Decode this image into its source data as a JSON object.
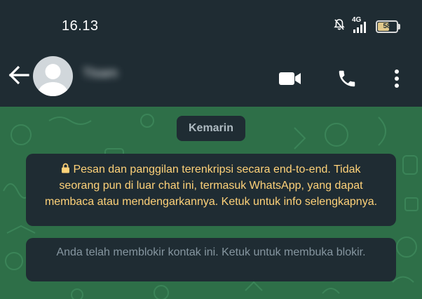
{
  "status_bar": {
    "time": "16.13",
    "network": "4G",
    "battery_level": "58",
    "icons": [
      "bell-off-icon",
      "signal-icon",
      "battery-icon"
    ]
  },
  "app_bar": {
    "contact_name": "Ttsam",
    "icons": [
      "back-arrow-icon",
      "avatar-placeholder-icon",
      "video-call-icon",
      "voice-call-icon",
      "more-vert-icon"
    ]
  },
  "chat": {
    "date_label": "Kemarin",
    "encryption_notice": "Pesan dan panggilan terenkripsi secara end-to-end. Tidak seorang pun di luar chat ini, termasuk WhatsApp, yang dapat membaca atau mendengarkannya. Ketuk untuk info selengkapnya.",
    "blocked_notice": "Anda telah memblokir kontak ini. Ketuk untuk membuka blokir."
  },
  "colors": {
    "bar": "#1f2c33",
    "chat_background": "#2e6f48",
    "notice_text": "#ffd279",
    "muted_text": "#8696a0"
  }
}
